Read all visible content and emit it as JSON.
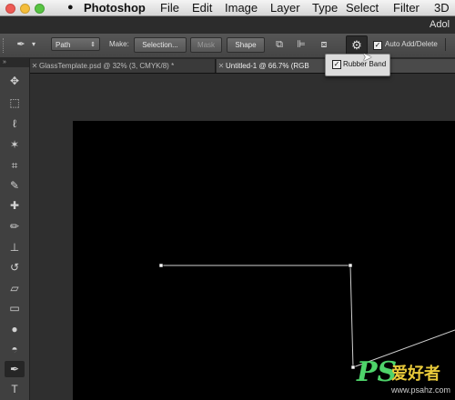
{
  "menubar": {
    "app_name": "Photoshop",
    "items": [
      "File",
      "Edit",
      "Image",
      "Layer",
      "Type",
      "Select",
      "Filter",
      "3D"
    ],
    "right_text": "Adol"
  },
  "options_bar": {
    "mode": "Path",
    "make_label": "Make:",
    "selection_btn": "Selection...",
    "mask_btn": "Mask",
    "shape_btn": "Shape",
    "auto_add_delete": "Auto Add/Delete",
    "auto_add_delete_checked": true
  },
  "tabs": [
    {
      "title": "GlassTemplate.psd @ 32% (3, CMYK/8) *",
      "active": false
    },
    {
      "title": "Untitled-1 @ 66.7% (RGB",
      "active": true
    }
  ],
  "popup": {
    "label": "Rubber Band",
    "checked": true
  },
  "toolbar": {
    "tools": [
      {
        "name": "move-tool-icon",
        "glyph": "✥"
      },
      {
        "name": "marquee-tool-icon",
        "glyph": "⬚"
      },
      {
        "name": "lasso-tool-icon",
        "glyph": "ℓ"
      },
      {
        "name": "magic-wand-tool-icon",
        "glyph": "✶"
      },
      {
        "name": "crop-tool-icon",
        "glyph": "⌗"
      },
      {
        "name": "eyedropper-tool-icon",
        "glyph": "✎"
      },
      {
        "name": "healing-brush-tool-icon",
        "glyph": "✚"
      },
      {
        "name": "brush-tool-icon",
        "glyph": "✏"
      },
      {
        "name": "stamp-tool-icon",
        "glyph": "⊥"
      },
      {
        "name": "history-brush-tool-icon",
        "glyph": "↺"
      },
      {
        "name": "eraser-tool-icon",
        "glyph": "▱"
      },
      {
        "name": "gradient-tool-icon",
        "glyph": "▭"
      },
      {
        "name": "blur-tool-icon",
        "glyph": "●"
      },
      {
        "name": "dodge-tool-icon",
        "glyph": "◓"
      },
      {
        "name": "pen-tool-icon",
        "glyph": "✒",
        "selected": true
      },
      {
        "name": "type-tool-icon",
        "glyph": "T"
      }
    ]
  },
  "watermark": {
    "logo": "PS",
    "chinese": "爱好者",
    "url": "www.psahz.com"
  },
  "colors": {
    "canvas": "#000000",
    "path_stroke": "#cfcfcf",
    "watermark_green": "#4ed36a",
    "watermark_yellow": "#e8c93a"
  }
}
